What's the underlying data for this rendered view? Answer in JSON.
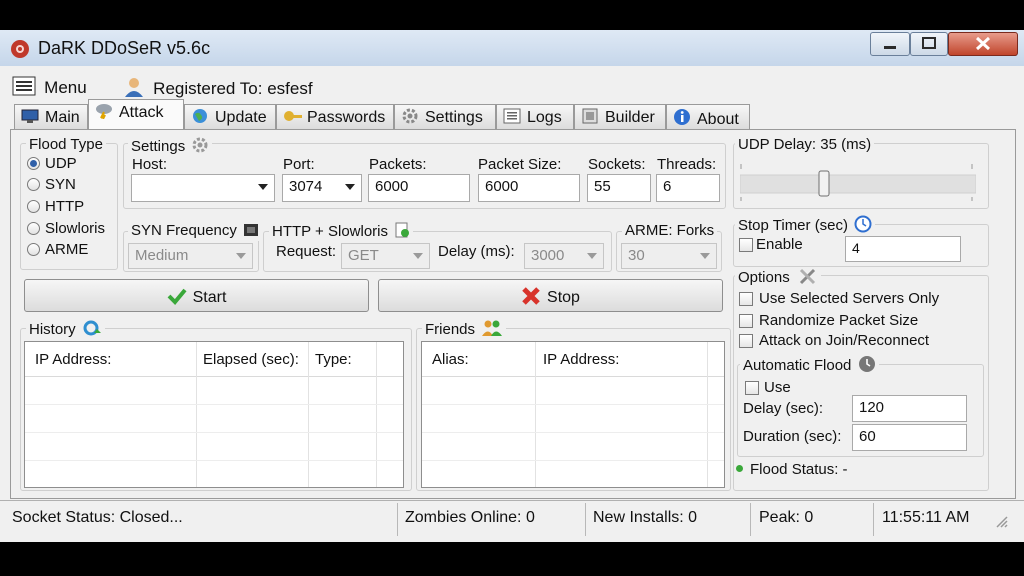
{
  "window": {
    "title": "DaRK DDoSeR v5.6c"
  },
  "menu": {
    "menu_label": "Menu",
    "registered_label": "Registered To: esfesf"
  },
  "tabs": [
    {
      "label": "Main",
      "icon": "monitor-icon"
    },
    {
      "label": "Attack",
      "icon": "storm-icon"
    },
    {
      "label": "Update",
      "icon": "globe-icon"
    },
    {
      "label": "Passwords",
      "icon": "key-icon"
    },
    {
      "label": "Settings",
      "icon": "gear-icon"
    },
    {
      "label": "Logs",
      "icon": "log-icon"
    },
    {
      "label": "Builder",
      "icon": "builder-icon"
    },
    {
      "label": "About",
      "icon": "info-icon"
    }
  ],
  "flood_type": {
    "label": "Flood Type",
    "options": [
      "UDP",
      "SYN",
      "HTTP",
      "Slowloris",
      "ARME"
    ],
    "selected": "UDP"
  },
  "settings": {
    "label": "Settings",
    "host_label": "Host:",
    "host_value": "",
    "port_label": "Port:",
    "port_value": "3074",
    "packets_label": "Packets:",
    "packets_value": "6000",
    "packet_size_label": "Packet Size:",
    "packet_size_value": "6000",
    "sockets_label": "Sockets:",
    "sockets_value": "55",
    "threads_label": "Threads:",
    "threads_value": "6"
  },
  "syn_frequency": {
    "label": "SYN Frequency",
    "value": "Medium"
  },
  "http_slowloris": {
    "label": "HTTP + Slowloris",
    "request_label": "Request:",
    "request_value": "GET",
    "delay_label": "Delay (ms):",
    "delay_value": "3000"
  },
  "arme": {
    "label": "ARME: Forks",
    "value": "30"
  },
  "buttons": {
    "start": "Start",
    "stop": "Stop"
  },
  "history": {
    "label": "History",
    "columns": [
      "IP Address:",
      "Elapsed (sec):",
      "Type:"
    ],
    "rows": []
  },
  "friends": {
    "label": "Friends",
    "columns": [
      "Alias:",
      "IP Address:"
    ],
    "rows": []
  },
  "udp_delay": {
    "label": "UDP Delay: 35 (ms)",
    "value_ms": 35,
    "slider_fraction": 0.45
  },
  "stop_timer": {
    "label": "Stop Timer (sec)",
    "enable_label": "Enable",
    "enabled": false,
    "value": "4"
  },
  "options": {
    "label": "Options",
    "items": [
      {
        "label": "Use Selected Servers Only",
        "checked": false
      },
      {
        "label": "Randomize Packet Size",
        "checked": false
      },
      {
        "label": "Attack on Join/Reconnect",
        "checked": false
      }
    ]
  },
  "automatic_flood": {
    "label": "Automatic Flood",
    "use_label": "Use",
    "use_checked": false,
    "delay_label": "Delay (sec):",
    "delay_value": "120",
    "duration_label": "Duration (sec):",
    "duration_value": "60"
  },
  "flood_status": {
    "text": "Flood Status: -",
    "indicator_color": "#3aa83a"
  },
  "status_bar": {
    "socket_status": "Socket Status: Closed...",
    "zombies": "Zombies Online: 0",
    "new_installs": "New Installs: 0",
    "peak": "Peak: 0",
    "clock": "11:55:11 AM"
  },
  "colors": {
    "start_check": "#3aa83a",
    "stop_x": "#d8332b",
    "accent": "#2f5fa8"
  }
}
